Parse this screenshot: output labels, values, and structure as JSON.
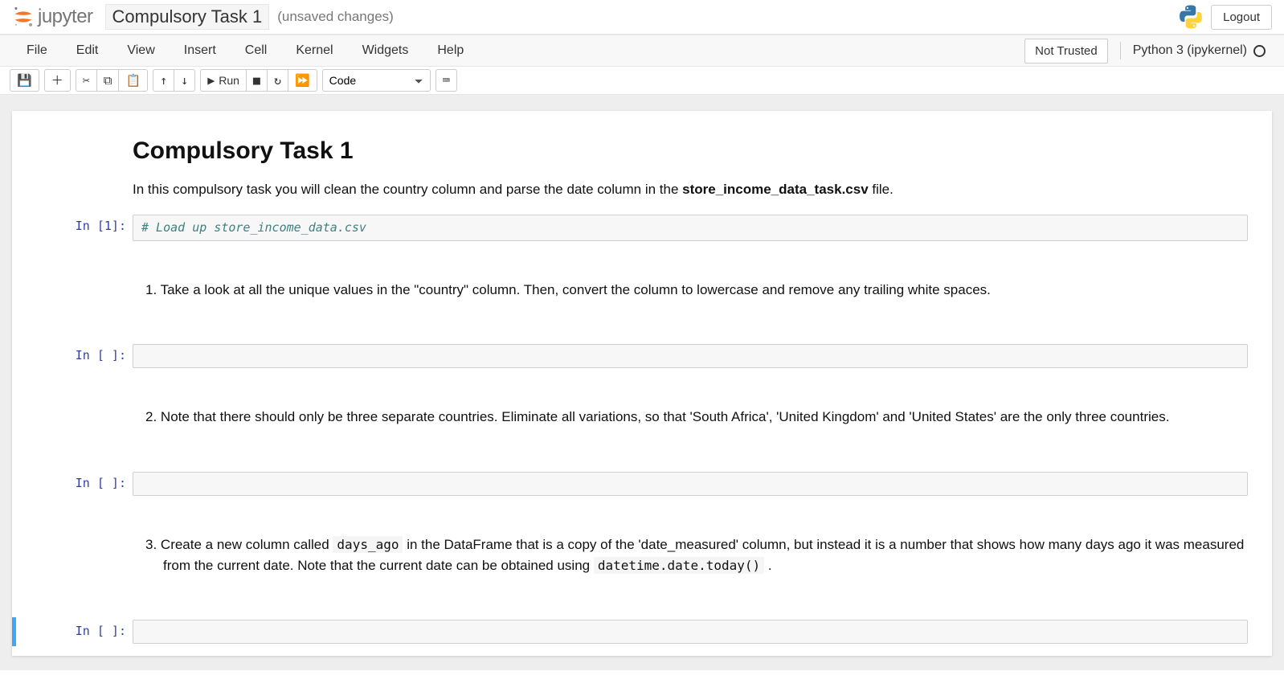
{
  "header": {
    "logo_text": "jupyter",
    "notebook_name": "Compulsory Task 1",
    "save_status": "(unsaved changes)",
    "logout": "Logout"
  },
  "menubar": {
    "items": [
      "File",
      "Edit",
      "View",
      "Insert",
      "Cell",
      "Kernel",
      "Widgets",
      "Help"
    ],
    "not_trusted": "Not Trusted",
    "kernel": "Python 3 (ipykernel)"
  },
  "toolbar": {
    "run_label": "Run",
    "celltype": "Code"
  },
  "cells": [
    {
      "type": "markdown",
      "h1": "Compulsory Task 1",
      "p_pre": "In this compulsory task you will clean the country column and parse the date column in the ",
      "p_bold": "store_income_data_task.csv",
      "p_post": " file."
    },
    {
      "type": "code",
      "prompt": "In [1]:",
      "source": "# Load up store_income_data.csv"
    },
    {
      "type": "markdown",
      "ol_num": "1.",
      "ol_text": " Take a look at all the unique values in the \"country\" column. Then, convert the column to lowercase and remove any trailing white spaces."
    },
    {
      "type": "code",
      "prompt": "In [ ]:",
      "source": ""
    },
    {
      "type": "markdown",
      "ol_num": "2.",
      "ol_text": " Note that there should only be three separate countries. Eliminate all variations, so that 'South Africa', 'United Kingdom' and 'United States' are the only three countries."
    },
    {
      "type": "code",
      "prompt": "In [ ]:",
      "source": ""
    },
    {
      "type": "markdown",
      "ol_num": "3.",
      "ol_pre": " Create a new column called ",
      "ol_code1": "days_ago",
      "ol_mid": " in the DataFrame that is a copy of the 'date_measured' column, but instead it is a number that shows how many days ago it was measured from the current date. Note that the current date can be obtained using ",
      "ol_code2": "datetime.date.today()",
      "ol_post": " ."
    },
    {
      "type": "code",
      "prompt": "In [ ]:",
      "source": "",
      "selected": true
    }
  ]
}
